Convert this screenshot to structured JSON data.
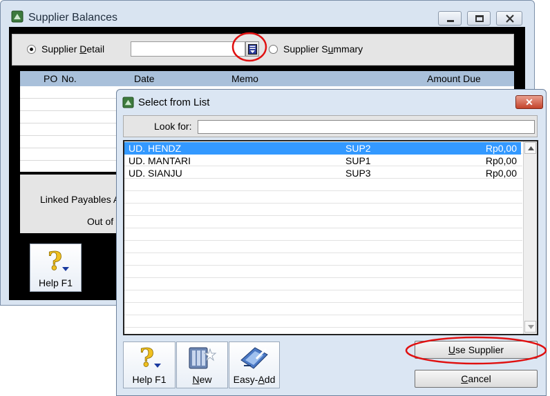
{
  "supplier_balances": {
    "title": "Supplier Balances",
    "supplier_detail_label_pre": "Supplier ",
    "supplier_detail_label_u": "D",
    "supplier_detail_label_post": "etail",
    "supplier_summary_label_pre": "Supplier S",
    "supplier_summary_label_u": "u",
    "supplier_summary_label_post": "mmary",
    "supplier_detail_selected": true,
    "supplier_field_value": "",
    "columns": {
      "po_no": "PO",
      "po_no2": "No.",
      "date": "Date",
      "memo": "Memo",
      "amount_due": "Amount Due"
    },
    "linked_payables_label": "Linked Payables A",
    "out_of_label": "Out of",
    "help_label": "Help F1"
  },
  "select_list": {
    "title": "Select from List",
    "close_symbol": "✕",
    "look_for_label": "Look for:",
    "look_for_value": "",
    "rows": [
      {
        "name": "UD. HENDZ",
        "code": "SUP2",
        "amount": "Rp0,00"
      },
      {
        "name": "UD. MANTARI",
        "code": "SUP1",
        "amount": "Rp0,00"
      },
      {
        "name": "UD. SIANJU",
        "code": "SUP3",
        "amount": "Rp0,00"
      }
    ],
    "help_label": "Help F1",
    "new_label_u": "N",
    "new_label_post": "ew",
    "easy_add_label_pre": "Easy-",
    "easy_add_label_u": "A",
    "easy_add_label_post": "dd",
    "use_supplier_label_u": "U",
    "use_supplier_label_post": "se Supplier",
    "cancel_label_pre": "",
    "cancel_label_u": "C",
    "cancel_label_post": "ancel"
  },
  "colors": {
    "window_bg": "#d9e4f1",
    "header_bar": "#a9c0da",
    "selection": "#3399ff",
    "annotation_red": "#e01010",
    "close_red": "#c4432b"
  }
}
